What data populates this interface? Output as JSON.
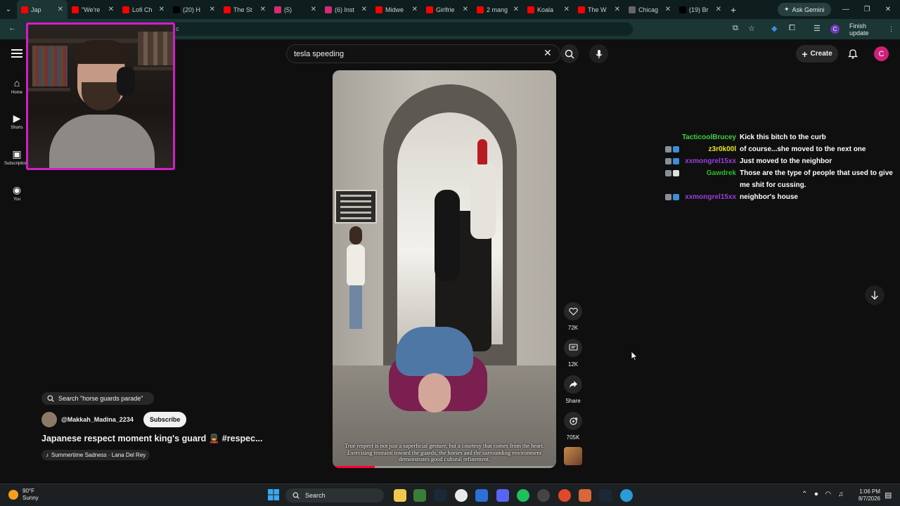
{
  "browser": {
    "tabs": [
      {
        "label": "Jap",
        "color": "#ff0000",
        "active": true
      },
      {
        "label": "\"We're",
        "color": "#ff0000"
      },
      {
        "label": "Lofi Ch",
        "color": "#ff0000"
      },
      {
        "label": "(20) H",
        "color": "#000000"
      },
      {
        "label": "The St",
        "color": "#ff0000"
      },
      {
        "label": "(5)",
        "color": "#d62976"
      },
      {
        "label": "(6) Inst",
        "color": "#d62976"
      },
      {
        "label": "Midwe",
        "color": "#ff0000"
      },
      {
        "label": "Girlfrie",
        "color": "#ff0000"
      },
      {
        "label": "2 mang",
        "color": "#ff0000"
      },
      {
        "label": "Koala",
        "color": "#ff0000"
      },
      {
        "label": "The W",
        "color": "#ff0000"
      },
      {
        "label": "Chicag",
        "color": "#666666"
      },
      {
        "label": "(19) Br",
        "color": "#000000"
      }
    ],
    "address_text": "c",
    "ask_gemini": "Ask Gemini",
    "finish_update": "Finish update",
    "profile_initial": "C"
  },
  "youtube": {
    "search_query": "tesla speeding",
    "create_label": "Create",
    "avatar_initial": "C",
    "sidebar": [
      {
        "label": "Home",
        "icon": "home-icon"
      },
      {
        "label": "Shorts",
        "icon": "shorts-icon"
      },
      {
        "label": "Subscriptions",
        "icon": "subscriptions-icon"
      },
      {
        "label": "You",
        "icon": "you-icon"
      }
    ],
    "actions": {
      "likes": "72K",
      "comments": "12K",
      "share": "Share",
      "remix": "705K"
    },
    "search_chip": "Search \"horse guards parade\"",
    "channel": "@Makkah_Madina_2234",
    "subscribe": "Subscribe",
    "video_title": "Japanese respect moment king's guard 💂 #respec...",
    "music": "Summertime Sadness · Lana Del Rey",
    "subtitle": "True respect is not just a superficial gesture, but a courtesy that comes from the heart. Exercising restraint toward the guards, the horses and the surrounding environment demonstrates good cultural refinement.",
    "progress": 0.19
  },
  "chat": [
    {
      "user": "TacticoolBrucey",
      "color": "#3fd13f",
      "badges": [],
      "text": "Kick this bitch to the curb"
    },
    {
      "user": "z3r0k00l",
      "color": "#e8e825",
      "badges": [
        "#8a8f96",
        "#3a8fd8"
      ],
      "text": "of course...she moved to the next one"
    },
    {
      "user": "xxmongrel15xx",
      "color": "#9b3fe0",
      "badges": [
        "#8a8f96",
        "#3a8fd8"
      ],
      "text": "Just moved to the neighbor"
    },
    {
      "user": "Gawdrek",
      "color": "#2fb82f",
      "badges": [
        "#8a8f96",
        "#e0e0e0"
      ],
      "text": "Those are the type of people that used to give me shit for cussing."
    },
    {
      "user": "xxmongrel15xx",
      "color": "#9b3fe0",
      "badges": [
        "#8a8f96",
        "#3a8fd8"
      ],
      "text": "neighbor's house"
    }
  ],
  "taskbar": {
    "temp": "90°F",
    "condition": "Sunny",
    "search": "Search",
    "time": "1:06 PM",
    "date": "8/7/2026"
  }
}
